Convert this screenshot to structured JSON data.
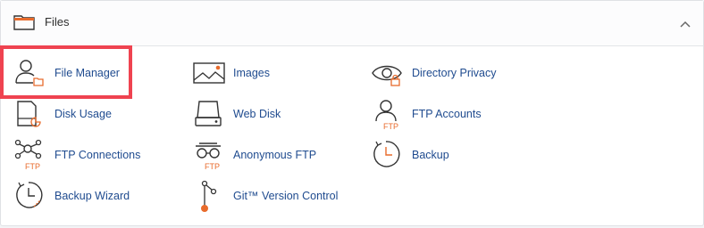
{
  "section": {
    "title": "Files",
    "collapse_icon": "chevron-up-icon"
  },
  "items": [
    {
      "label": "File Manager",
      "icon": "file-manager-icon"
    },
    {
      "label": "Images",
      "icon": "image-icon"
    },
    {
      "label": "Directory Privacy",
      "icon": "eye-lock-icon"
    },
    {
      "label": "Disk Usage",
      "icon": "disk-usage-icon"
    },
    {
      "label": "Web Disk",
      "icon": "web-disk-icon"
    },
    {
      "label": "FTP Accounts",
      "icon": "ftp-user-icon"
    },
    {
      "label": "FTP Connections",
      "icon": "ftp-connections-icon"
    },
    {
      "label": "Anonymous FTP",
      "icon": "anonymous-ftp-icon"
    },
    {
      "label": "Backup",
      "icon": "backup-icon"
    },
    {
      "label": "Backup Wizard",
      "icon": "backup-wizard-icon"
    },
    {
      "label": "Git™ Version Control",
      "icon": "git-icon"
    }
  ],
  "ftp_text": "FTP",
  "colors": {
    "accent": "#e86b2c",
    "link": "#1f4b8f",
    "highlight": "#ef4350"
  }
}
